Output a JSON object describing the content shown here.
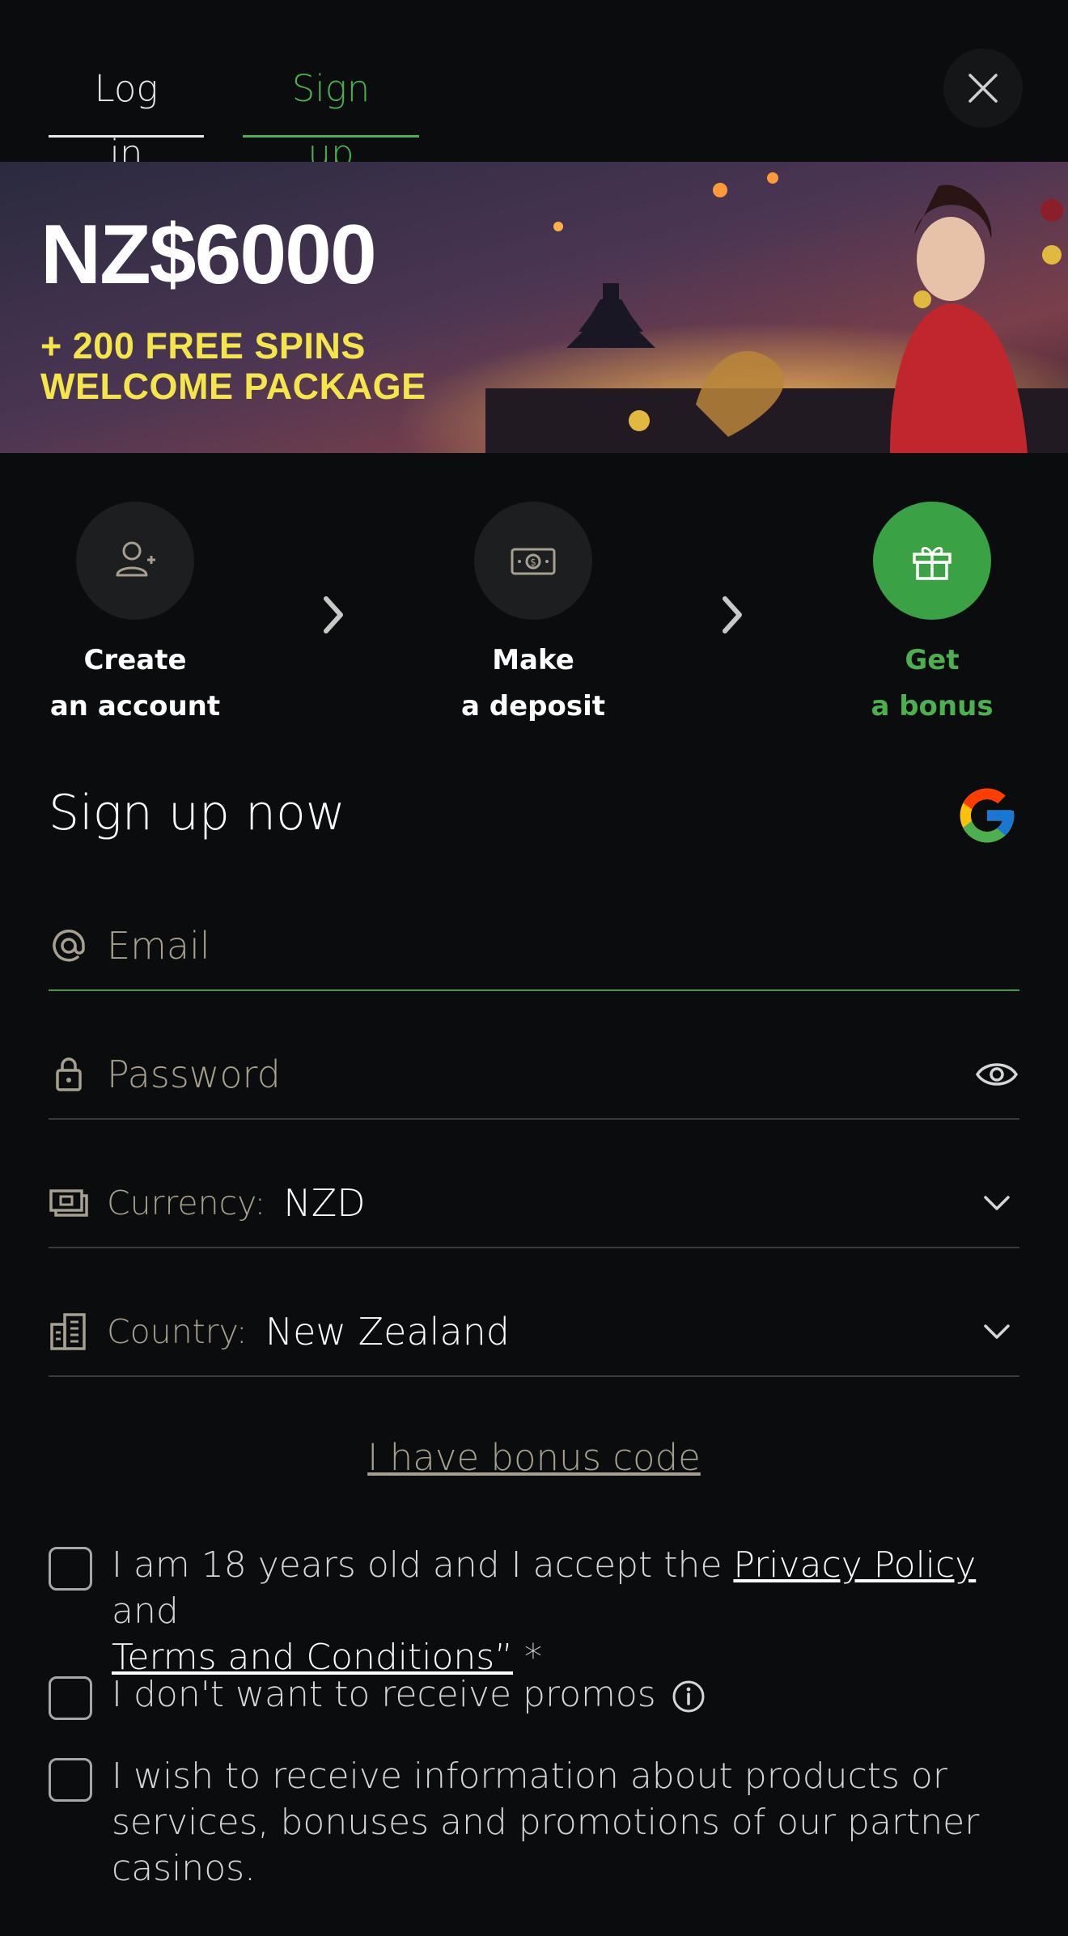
{
  "tabs": {
    "login": "Log in",
    "signup": "Sign up"
  },
  "banner": {
    "amount": "NZ$6000",
    "line1": "+ 200 FREE SPINS",
    "line2": "WELCOME PACKAGE"
  },
  "steps": [
    {
      "line1": "Create",
      "line2": "an account",
      "icon": "user-add-icon"
    },
    {
      "line1": "Make",
      "line2": "a deposit",
      "icon": "money-icon"
    },
    {
      "line1": "Get",
      "line2": "a bonus",
      "icon": "gift-icon"
    }
  ],
  "form": {
    "title": "Sign up now",
    "email_placeholder": "Email",
    "password_placeholder": "Password",
    "currency_label": "Currency:",
    "currency_value": "NZD",
    "country_label": "Country:",
    "country_value": "New Zealand",
    "bonus_code": "I have bonus code"
  },
  "checkboxes": {
    "age_prefix": "I am 18 years old and I accept the ",
    "privacy": "Privacy Policy",
    "and": " and ",
    "terms": "Terms and Conditions”",
    "star": " *",
    "promos": "I don't want to receive promos",
    "partners": "I wish to receive information about products or services, bonuses and promotions of our partner casinos."
  },
  "colors": {
    "accent": "#4caf50",
    "banner_text": "#f4e64a",
    "background": "#0b0c0d"
  }
}
